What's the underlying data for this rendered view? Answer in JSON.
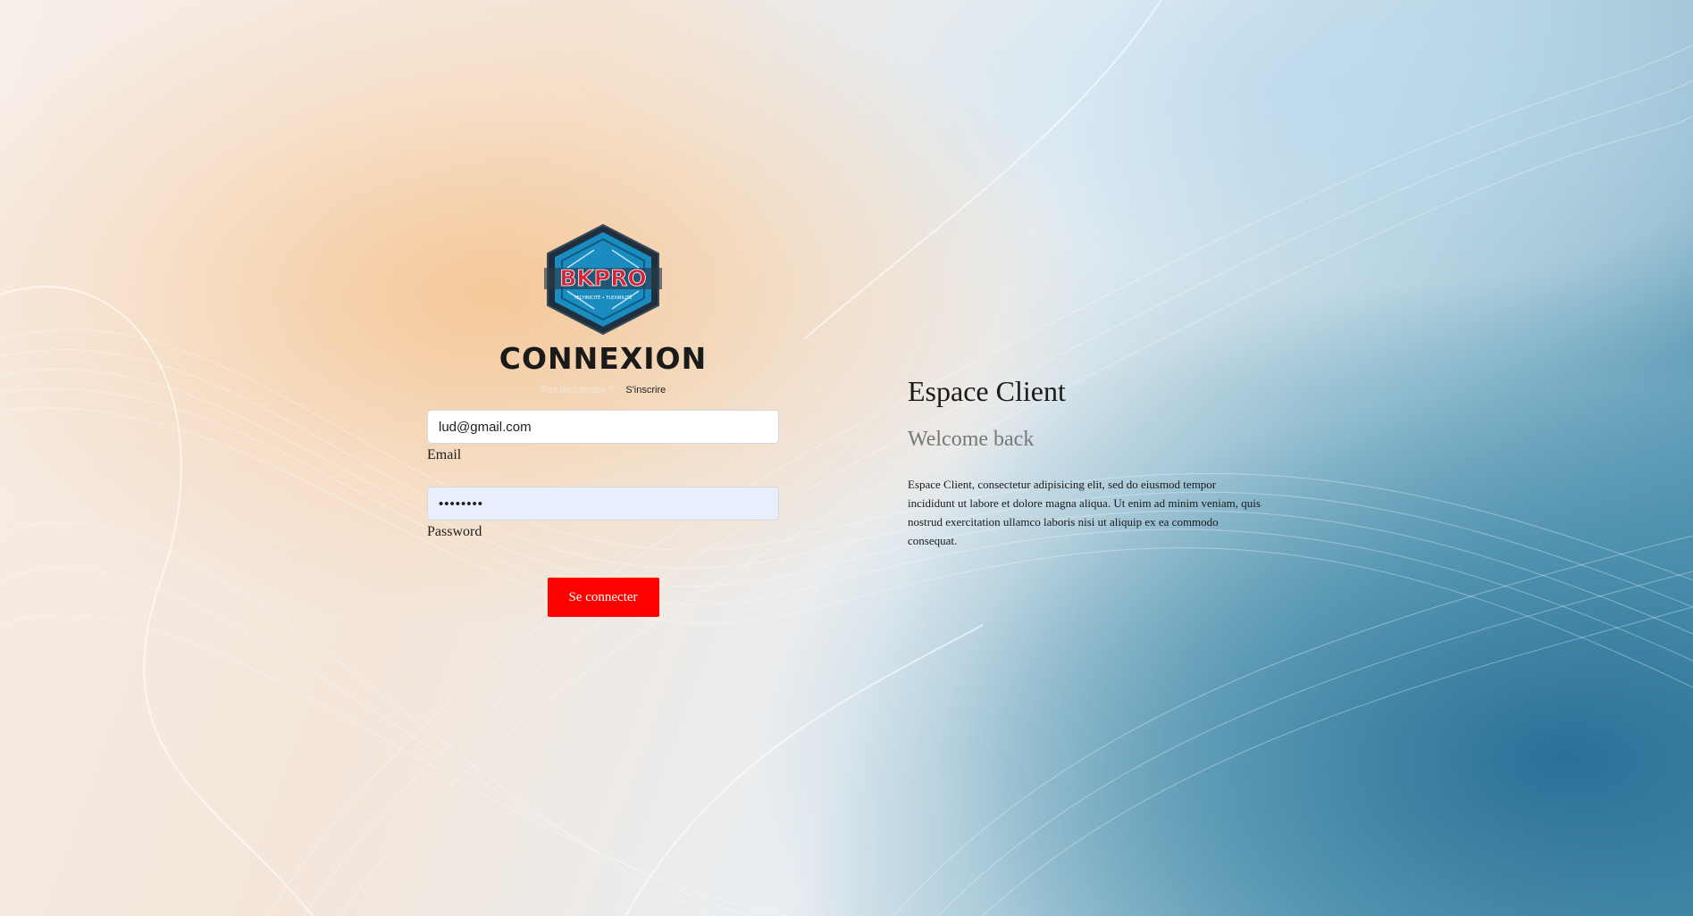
{
  "logo": {
    "text": "BKPRO",
    "tagline": "TECHNICITÉ • FLEXIBILITÉ"
  },
  "login": {
    "title": "CONNEXION",
    "no_account_text": "Pas de compte ?",
    "signup_link": "S'inscrire",
    "email_value": "lud@gmail.com",
    "email_label": "Email",
    "password_value": "••••••••",
    "password_label": "Password",
    "submit_label": "Se connecter"
  },
  "welcome": {
    "title": "Espace Client",
    "subtitle": "Welcome back",
    "body": "Espace Client, consectetur adipisicing elit, sed do eiusmod tempor incididunt ut labore et dolore magna aliqua. Ut enim ad minim veniam, quis nostrud exercitation ullamco laboris nisi ut aliquip ex ea commodo consequat."
  },
  "colors": {
    "accent": "#ff0000",
    "password_bg": "#e8eefb",
    "logo_blue": "#1a8cc0",
    "logo_red": "#d4243a"
  }
}
